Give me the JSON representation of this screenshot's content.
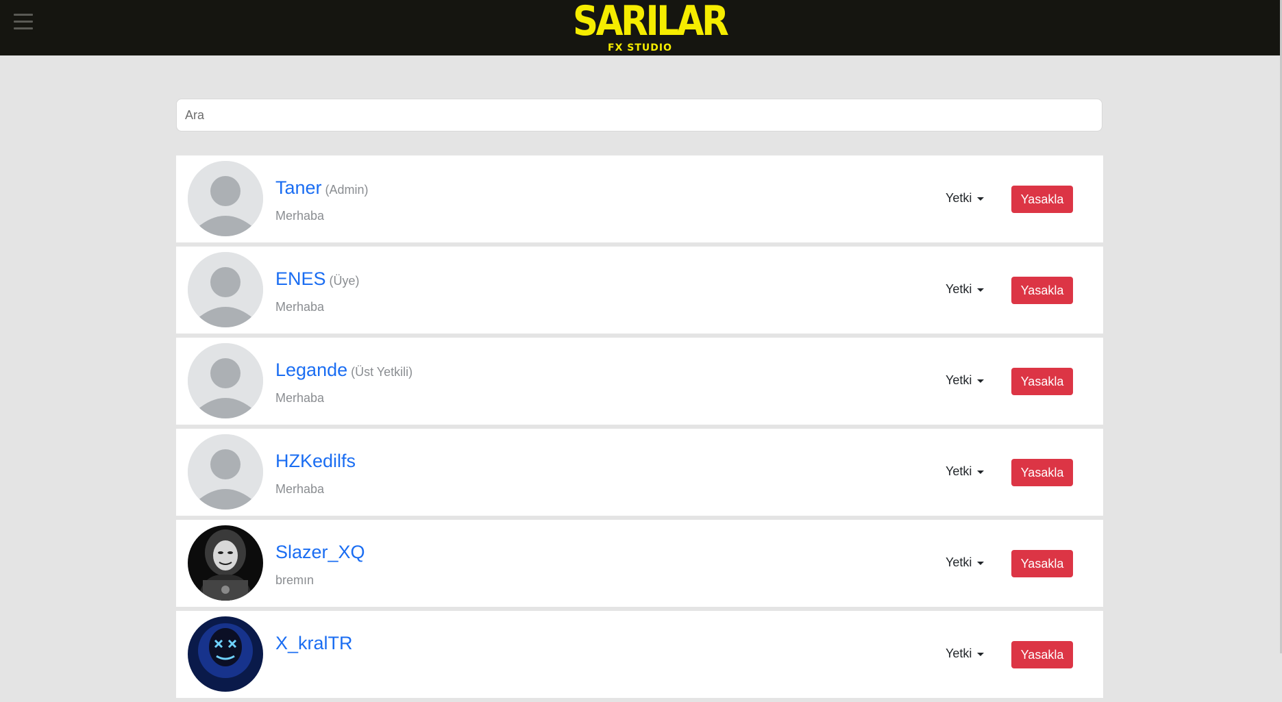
{
  "header": {
    "menu_icon": "hamburger-menu-icon",
    "logo_main": "SARILAR",
    "logo_sub": "FX STUDIO",
    "logo_color": "#f5ec00",
    "background_color": "#151510"
  },
  "search": {
    "placeholder": "Ara",
    "value": ""
  },
  "users": [
    {
      "name": "Taner",
      "role": "(Admin)",
      "status": "Merhaba",
      "avatar": "default-avatar",
      "permission_label": "Yetki",
      "ban_label": "Yasakla"
    },
    {
      "name": "ENES",
      "role": "(Üye)",
      "status": "Merhaba",
      "avatar": "default-avatar",
      "permission_label": "Yetki",
      "ban_label": "Yasakla"
    },
    {
      "name": "Legande",
      "role": "(Üst Yetkili)",
      "status": "Merhaba",
      "avatar": "default-avatar",
      "permission_label": "Yetki",
      "ban_label": "Yasakla"
    },
    {
      "name": "HZKedilfs",
      "role": "",
      "status": "Merhaba",
      "avatar": "default-avatar",
      "permission_label": "Yetki",
      "ban_label": "Yasakla"
    },
    {
      "name": "Slazer_XQ",
      "role": "",
      "status": "bremın",
      "avatar": "hooded-hacker-photo",
      "permission_label": "Yetki",
      "ban_label": "Yasakla"
    },
    {
      "name": "X_kralTR",
      "role": "",
      "status": "",
      "avatar": "blue-neon-mask-photo",
      "permission_label": "Yetki",
      "ban_label": "Yasakla"
    }
  ],
  "colors": {
    "link": "#1a6df2",
    "ban_button": "#dc3545",
    "muted_text": "#8a8d91",
    "page_background": "#e4e4e4"
  }
}
